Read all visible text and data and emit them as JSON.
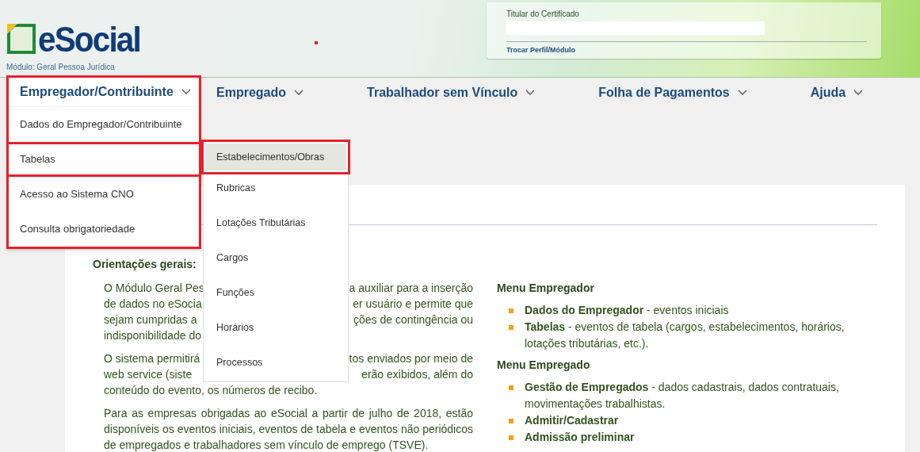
{
  "header": {
    "logo_text": "eSocial",
    "module": "Módulo: Geral Pessoa Jurídica",
    "certificate": {
      "label": "Titular do Certificado",
      "link": "Trocar Perfil/Módulo"
    }
  },
  "nav": [
    {
      "label": "Empregador/Contribuinte",
      "expanded": true
    },
    {
      "label": "Empregado",
      "expanded": false
    },
    {
      "label": "Trabalhador sem Vínculo",
      "expanded": false
    },
    {
      "label": "Folha de Pagamentos",
      "expanded": false
    },
    {
      "label": "Ajuda",
      "expanded": false
    }
  ],
  "dropdown": {
    "highlighted": true,
    "items": [
      {
        "label": "Dados do Empregador/Contribuinte",
        "highlighted": false
      },
      {
        "label": "Tabelas",
        "highlighted": true
      },
      {
        "label": "Acesso ao Sistema CNO",
        "highlighted": false
      },
      {
        "label": "Consulta obrigatoriedade",
        "highlighted": false
      }
    ]
  },
  "submenu": [
    {
      "label": "Estabelecimentos/Obras",
      "selected": true,
      "highlighted": true
    },
    {
      "label": "Rubricas",
      "selected": false,
      "highlighted": false
    },
    {
      "label": "Lotações Tributárias",
      "selected": false,
      "highlighted": false
    },
    {
      "label": "Cargos",
      "selected": false,
      "highlighted": false
    },
    {
      "label": "Funções",
      "selected": false,
      "highlighted": false
    },
    {
      "label": "Horários",
      "selected": false,
      "highlighted": false
    },
    {
      "label": "Processos",
      "selected": false,
      "highlighted": false
    }
  ],
  "content": {
    "left": {
      "heading": "Orientações gerais:",
      "paragraphs": [
        {
          "lines": [
            [
              "O Módulo Geral Pes",
              "a auxiliar para a inserção"
            ],
            [
              "de dados no eSocia",
              "er usuário e permite que"
            ],
            [
              "sejam cumpridas a",
              "ções de contingência ou"
            ],
            [
              "indisponibilidade do"
            ]
          ]
        },
        {
          "lines": [
            [
              "O sistema permitirá",
              "tos enviados por meio de"
            ],
            [
              "web service (siste",
              "erão exibidos, além do"
            ],
            [
              "conteúdo do evento, os números de recibo."
            ]
          ]
        },
        {
          "text": "Para as empresas obrigadas ao eSocial a partir de julho de 2018, estão disponíveis os eventos iniciais, eventos de tabela e eventos não periódicos de empregados e trabalhadores sem vínculo de emprego (TSVE)."
        }
      ]
    },
    "right": [
      {
        "heading": "Menu Empregador",
        "items": [
          "**Dados do Empregador** - eventos iniciais",
          "**Tabelas** - eventos de tabela (cargos, estabelecimentos, horários, lotações tributárias, etc.)."
        ]
      },
      {
        "heading": "Menu Empregado",
        "items": [
          "**Gestão de Empregados** - dados cadastrais, dados contratuais, movimentações trabalhistas.",
          "**Admitir/Cadastrar**",
          "**Admissão preliminar**"
        ]
      }
    ]
  }
}
